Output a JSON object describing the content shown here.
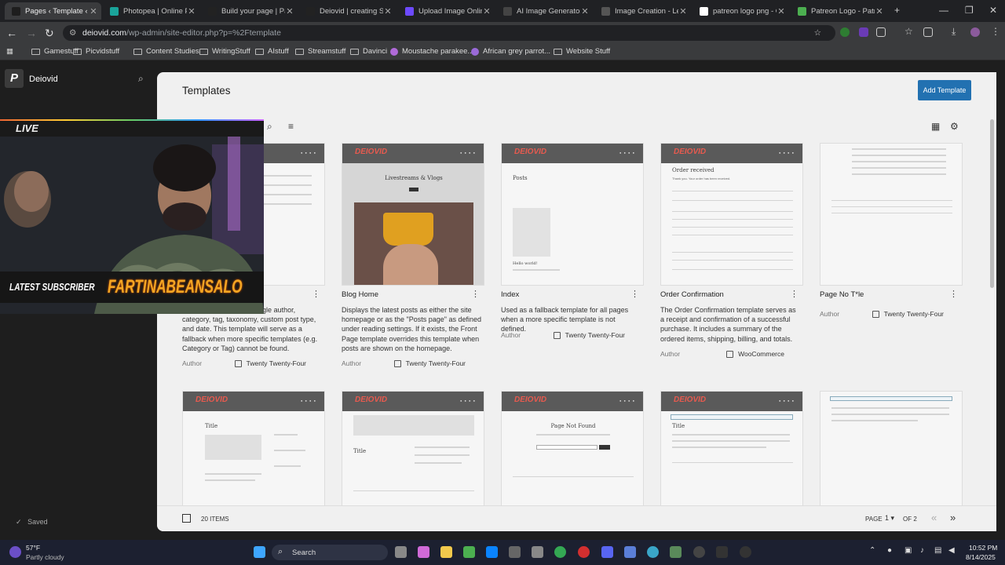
{
  "tabs": [
    {
      "title": "Pages ‹ Template ‹ De",
      "color": "#1e1e1e",
      "active": true
    },
    {
      "title": "Photopea | Online Ph",
      "color": "#1aa39a"
    },
    {
      "title": "Build your page | Patr",
      "color": "#222"
    },
    {
      "title": "Deiovid | creating Stre",
      "color": "#222"
    },
    {
      "title": "Upload Image Online",
      "color": "#6d4aff"
    },
    {
      "title": "AI Image Generator -",
      "color": "#444"
    },
    {
      "title": "Image Creation - Leo",
      "color": "#555"
    },
    {
      "title": "patreon logo png - G",
      "color": "#fff"
    },
    {
      "title": "Patreon Logo - Patre",
      "color": "#4caf50"
    }
  ],
  "address": {
    "domain": "deiovid.com",
    "path": "/wp-admin/site-editor.php?p=%2Ftemplate"
  },
  "bookmarks": [
    "Gamestuff",
    "Picvidstuff",
    "Content Studies",
    "WritingStuff",
    "AIstuff",
    "Streamstuff",
    "Davinci",
    "Moustache parakee...",
    "African grey parrot...",
    "Website Stuff"
  ],
  "site": {
    "name": "Deiovid",
    "logo": "P",
    "saved": "Saved"
  },
  "page": {
    "title": "Templates",
    "add_label": "Add Template",
    "items": "20 ITEMS",
    "page_label": "PAGE",
    "page_num": "1",
    "page_of": "OF 2"
  },
  "templates_row1": [
    {
      "title": "",
      "desc": "…including posts by a single author, category, tag, taxonomy, custom post type, and date. This template will serve as a fallback when more specific templates (e.g. Category or Tag) cannot be found.",
      "author": "Author",
      "theme": "Twenty Twenty-Four"
    },
    {
      "title": "Blog Home",
      "desc": "Displays the latest posts as either the site homepage or as the \"Posts page\" as defined under reading settings. If it exists, the Front Page template overrides this template when posts are shown on the homepage.",
      "author": "Author",
      "theme": "Twenty Twenty-Four"
    },
    {
      "title": "Index",
      "desc": "Used as a fallback template for all pages when a more specific template is not defined.",
      "author": "Author",
      "theme": "Twenty Twenty-Four"
    },
    {
      "title": "Order Confirmation",
      "desc": "The Order Confirmation template serves as a receipt and confirmation of a successful purchase. It includes a summary of the ordered items, shipping, billing, and totals.",
      "author": "Author",
      "theme": "WooCommerce"
    },
    {
      "title": "Page No T*le",
      "desc": "",
      "author": "Author",
      "theme": "Twenty Twenty-Four"
    }
  ],
  "thumb_text": {
    "blog_heading": "Livestreams & Vlogs",
    "posts": "Posts",
    "order": "Order received",
    "order_thanks": "Thank you. Your order has been received.",
    "title": "Title",
    "notfound": "Page Not Found",
    "hello": "Hello world!"
  },
  "overlay": {
    "live": "LIVE",
    "sub_label": "LATEST SUBSCRIBER",
    "sub_name": "FARTINABEANSALO"
  },
  "taskbar": {
    "temp": "57°F",
    "weather": "Partly cloudy",
    "search": "Search",
    "time": "10:52 PM",
    "date": "8/14/2025"
  }
}
